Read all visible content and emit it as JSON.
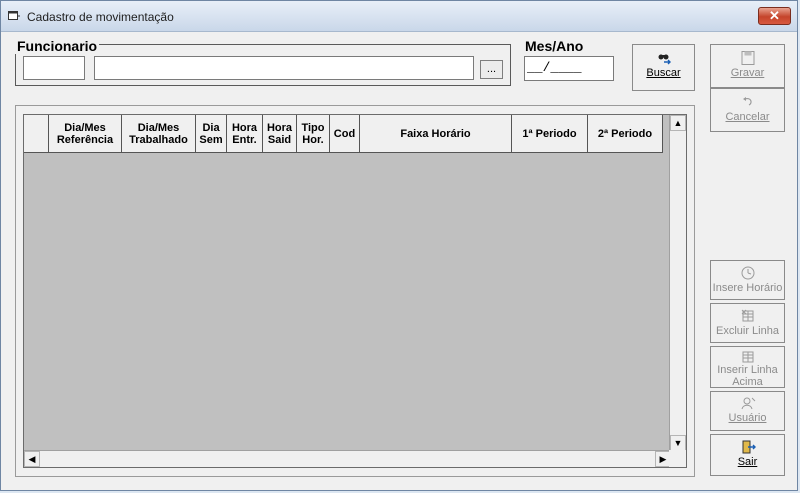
{
  "window": {
    "title": "Cadastro de movimentação",
    "close_label": "✕"
  },
  "funcionario": {
    "label": "Funcionario",
    "code_value": "",
    "name_value": "",
    "browse_label": "..."
  },
  "mesano": {
    "label": "Mes/Ano",
    "value": "__/____"
  },
  "buttons": {
    "buscar": {
      "label": "Buscar"
    },
    "gravar": {
      "label": "Gravar"
    },
    "cancelar": {
      "label": "Cancelar"
    },
    "insere_horario": {
      "label": "Insere Horário"
    },
    "excluir_linha": {
      "label": "Excluir Linha"
    },
    "inserir_linha_line1": "Inserir Linha",
    "inserir_linha_line2": "Acima",
    "usuario": {
      "label": "Usuário"
    },
    "sair": {
      "label": "Sair"
    }
  },
  "grid": {
    "columns": [
      {
        "line1": "",
        "line2": ""
      },
      {
        "line1": "Dia/Mes",
        "line2": "Referência"
      },
      {
        "line1": "Dia/Mes",
        "line2": "Trabalhado"
      },
      {
        "line1": "Dia",
        "line2": "Sem"
      },
      {
        "line1": "Hora",
        "line2": "Entr."
      },
      {
        "line1": "Hora",
        "line2": "Said"
      },
      {
        "line1": "Tipo",
        "line2": "Hor."
      },
      {
        "line1": "Cod",
        "line2": ""
      },
      {
        "line1": "Faixa Horário",
        "line2": ""
      },
      {
        "line1": "1ª Periodo",
        "line2": ""
      },
      {
        "line1": "2ª Periodo",
        "line2": ""
      }
    ]
  }
}
